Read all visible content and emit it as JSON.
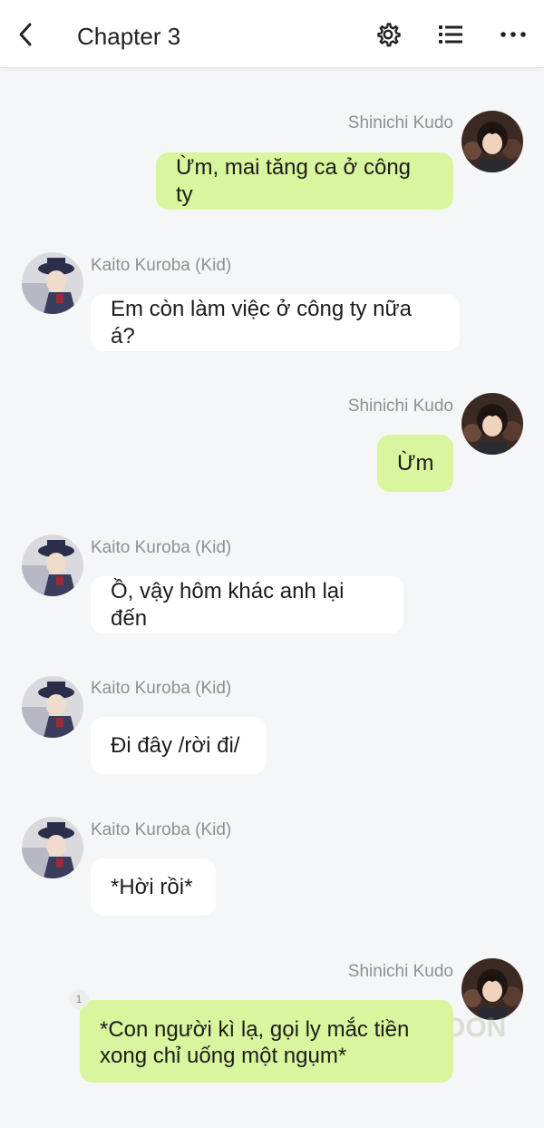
{
  "header": {
    "title": "Chapter 3",
    "back_icon": "chevron-left-icon",
    "settings_icon": "gear-icon",
    "list_icon": "list-icon",
    "more_icon": "more-icon"
  },
  "colors": {
    "sent_bubble": "#d9f59d",
    "received_bubble": "#ffffff",
    "background": "#f5f6f8",
    "name_text": "#8d8f94"
  },
  "messages": [
    {
      "sender": "Shinichi Kudo",
      "side": "right",
      "text": "Ừm, mai tăng ca ở công ty"
    },
    {
      "sender": "Kaito Kuroba (Kid)",
      "side": "left",
      "text": "Em còn làm việc ở công ty nữa á?"
    },
    {
      "sender": "Shinichi Kudo",
      "side": "right",
      "text": "Ừm"
    },
    {
      "sender": "Kaito Kuroba (Kid)",
      "side": "left",
      "text": "Ồ, vậy hôm khác anh lại đến"
    },
    {
      "sender": "Kaito Kuroba (Kid)",
      "side": "left",
      "text": "Đi đây /rời đi/"
    },
    {
      "sender": "Kaito Kuroba (Kid)",
      "side": "left",
      "text": "*Hời rồi*"
    },
    {
      "sender": "Shinichi Kudo",
      "side": "right",
      "text_line1": "*Con người kì lạ, gọi ly mắc tiền",
      "text_line2": "xong chỉ uống một ngụm*",
      "comment_count": "1"
    }
  ],
  "watermark": "OON"
}
